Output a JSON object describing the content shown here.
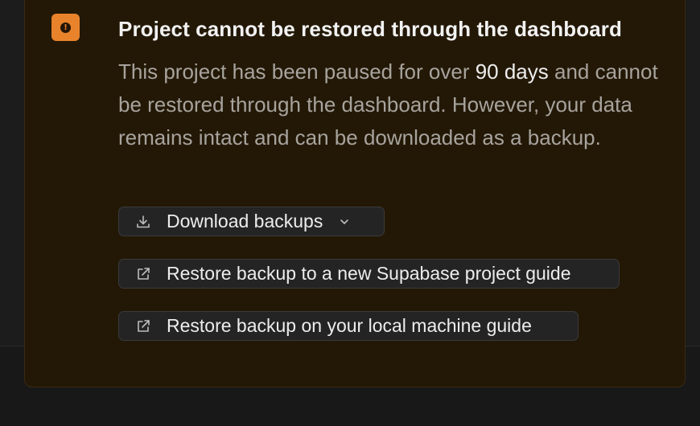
{
  "alert": {
    "icon": "exclamation-icon",
    "accent_color": "#e8832c",
    "title": "Project cannot be restored through the dashboard",
    "description": {
      "part1": "This project has been paused for over ",
      "highlight": "90 days",
      "part2": " and cannot be restored through the dashboard. However, your data remains intact and can be downloaded as a backup."
    }
  },
  "actions": {
    "download": {
      "label": "Download backups",
      "icon": "download-icon",
      "trailing_icon": "chevron-down-icon"
    },
    "guide_new_project": {
      "label": "Restore backup to a new Supabase project guide",
      "icon": "external-link-icon"
    },
    "guide_local": {
      "label": "Restore backup on your local machine guide",
      "icon": "external-link-icon"
    }
  }
}
